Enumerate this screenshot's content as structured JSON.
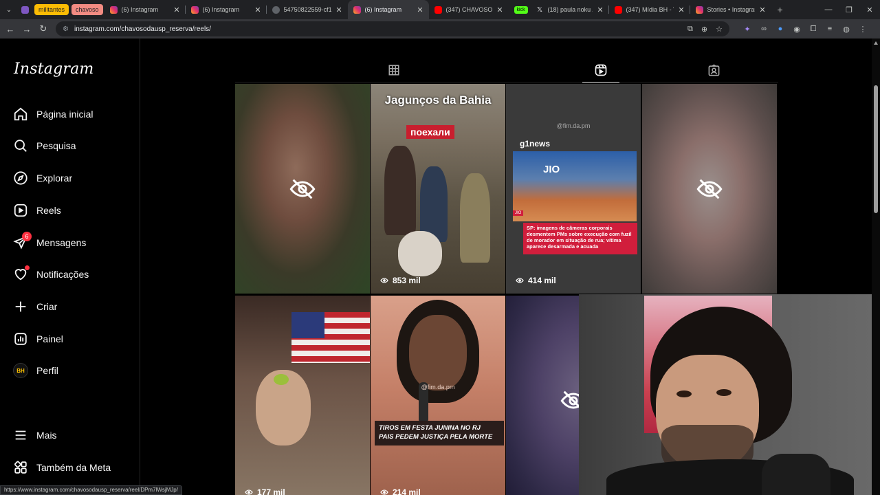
{
  "browser": {
    "tab_groups": [
      {
        "label": "militantes",
        "color": "#fbbc04"
      },
      {
        "label": "chavoso",
        "color": "#f28b82"
      }
    ],
    "tabs": [
      {
        "title": "(6) Instagram",
        "favicon": "instagram-icon"
      },
      {
        "title": "(6) Instagram",
        "favicon": "instagram-icon"
      },
      {
        "title": "54750822559-cf1cd",
        "favicon": "globe-icon"
      },
      {
        "title": "(6) Instagram",
        "favicon": "instagram-icon",
        "active": true
      },
      {
        "title": "(347) CHAVOSO DA",
        "favicon": "youtube-icon"
      },
      {
        "title": "(18) paula noku /(",
        "favicon": "x-icon",
        "group_chip": "kick"
      },
      {
        "title": "(347) Mídia BH - Yo",
        "favicon": "youtube-icon"
      },
      {
        "title": "Stories • Instagram",
        "favicon": "instagram-icon"
      }
    ],
    "url": "instagram.com/chavosodausp_reserva/reels/",
    "status_url": "https://www.instagram.com/chavosodausp_reserva/reel/DPm7lWsjMJp/"
  },
  "sidebar": {
    "logo": "Instagram",
    "items": [
      {
        "label": "Página inicial",
        "icon": "home-icon"
      },
      {
        "label": "Pesquisa",
        "icon": "search-icon"
      },
      {
        "label": "Explorar",
        "icon": "compass-icon"
      },
      {
        "label": "Reels",
        "icon": "reels-icon"
      },
      {
        "label": "Mensagens",
        "icon": "messenger-icon",
        "badge": "6"
      },
      {
        "label": "Notificações",
        "icon": "heart-icon",
        "dot": true
      },
      {
        "label": "Criar",
        "icon": "plus-icon"
      },
      {
        "label": "Painel",
        "icon": "dashboard-icon"
      },
      {
        "label": "Perfil",
        "icon": "avatar"
      },
      {
        "label": "Mais",
        "icon": "menu-icon"
      },
      {
        "label": "Também da Meta",
        "icon": "meta-apps-icon"
      }
    ],
    "profile_avatar_text": "BH"
  },
  "profile_tabs": [
    {
      "name": "posts",
      "icon": "grid-icon"
    },
    {
      "name": "reels",
      "icon": "reels-icon",
      "active": true
    },
    {
      "name": "tagged",
      "icon": "tagged-icon"
    }
  ],
  "reels": [
    {
      "hidden": true,
      "views": ""
    },
    {
      "hidden": false,
      "views": "853 mil",
      "overlay_title": "Jagunços da Bahia",
      "overlay_sub": "поехали"
    },
    {
      "hidden": false,
      "views": "414 mil",
      "handle": "@fim.da.pm",
      "brand": "g1news",
      "studio_text": "JIO",
      "tag": "JIO",
      "caption": "SP: imagens de câmeras corporais desmentem PMs sobre execução com fuzil de morador em situação de rua; vítima aparece desarmada e acuada"
    },
    {
      "hidden": true,
      "views": ""
    },
    {
      "hidden": false,
      "views": "177 mil"
    },
    {
      "hidden": false,
      "views": "214 mil",
      "handle": "@fim.da.pm",
      "banner_line1": "TIROS EM FESTA JUNINA NO RJ",
      "banner_line2": "PAIS PEDEM JUSTIÇA PELA MORTE"
    },
    {
      "hidden": true,
      "views": ""
    }
  ]
}
